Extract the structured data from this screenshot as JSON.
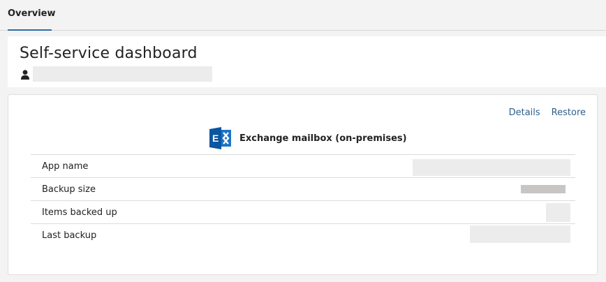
{
  "tabs": [
    {
      "label": "Overview"
    }
  ],
  "header": {
    "title": "Self-service dashboard",
    "user_icon": "user-icon"
  },
  "card": {
    "links": {
      "details": "Details",
      "restore": "Restore"
    },
    "app": {
      "icon": "exchange-icon",
      "title": "Exchange mailbox (on-premises)"
    },
    "rows": [
      {
        "label": "App name"
      },
      {
        "label": "Backup size"
      },
      {
        "label": "Items backed up"
      },
      {
        "label": "Last backup"
      }
    ]
  },
  "colors": {
    "accent": "#2e6da4",
    "link": "#2e5f8a",
    "exchange_blue": "#0a64b4"
  }
}
